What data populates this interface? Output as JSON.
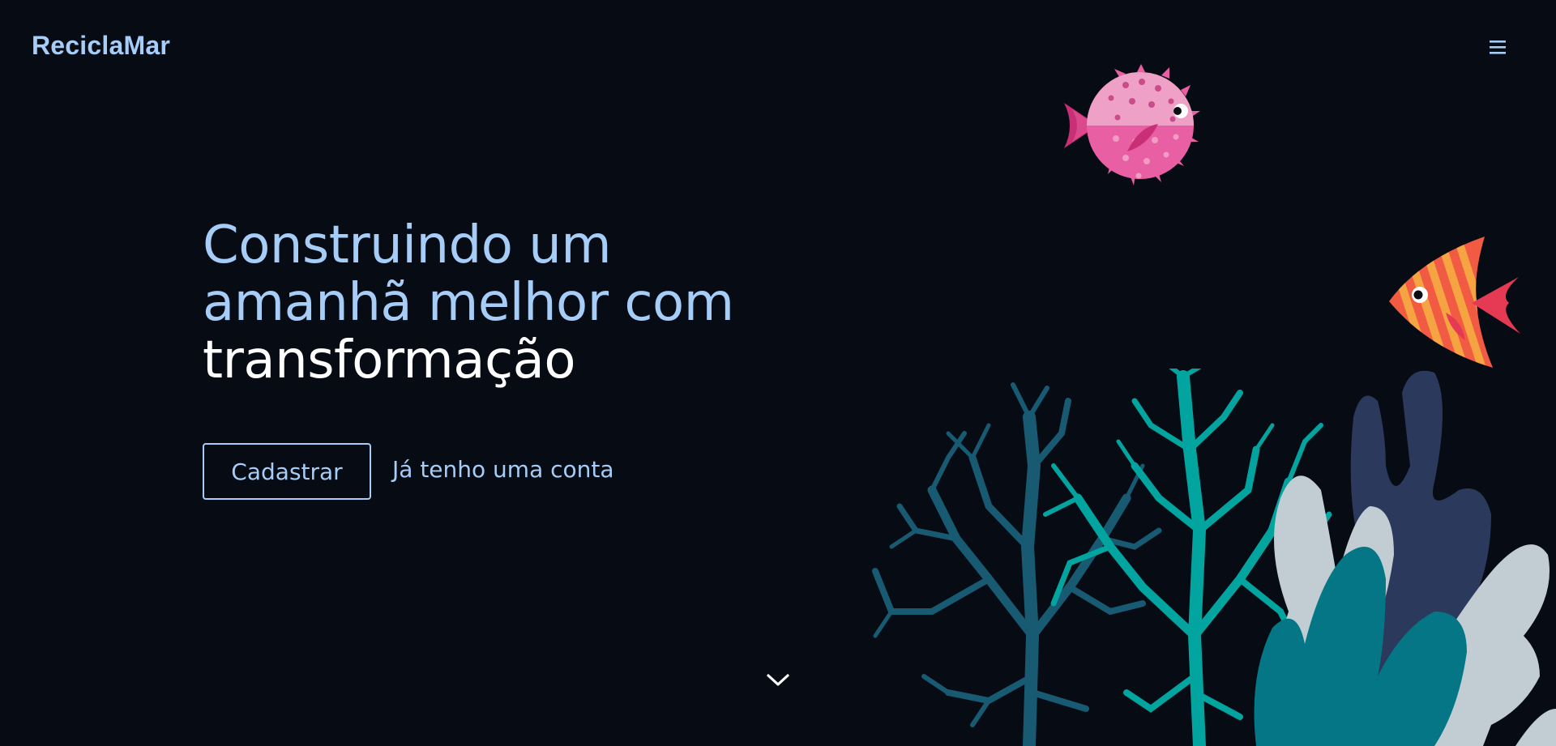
{
  "header": {
    "brand": "ReciclaMar",
    "menu_icon": "hamburger-menu-icon"
  },
  "hero": {
    "title_line1": "Construindo um",
    "title_line2": "amanhã melhor com",
    "title_line3": "transformação",
    "signup_label": "Cadastrar",
    "login_label": "Já tenho uma conta",
    "scroll_icon": "chevron-down-icon"
  },
  "illustrations": [
    "pufferfish-illustration",
    "striped-fish-illustration",
    "coral-reef-illustration"
  ],
  "colors": {
    "background": "#060b14",
    "accent": "#a6cdf7",
    "text_white": "#ffffff",
    "coral_teal": "#01a49e",
    "coral_dark_teal": "#175a72",
    "coral_navy": "#2b3a5c",
    "coral_grey": "#c2cdd3",
    "coral_petrol": "#047685",
    "pufferfish_pink": "#e95fa3",
    "fish_orange": "#f15a43"
  }
}
